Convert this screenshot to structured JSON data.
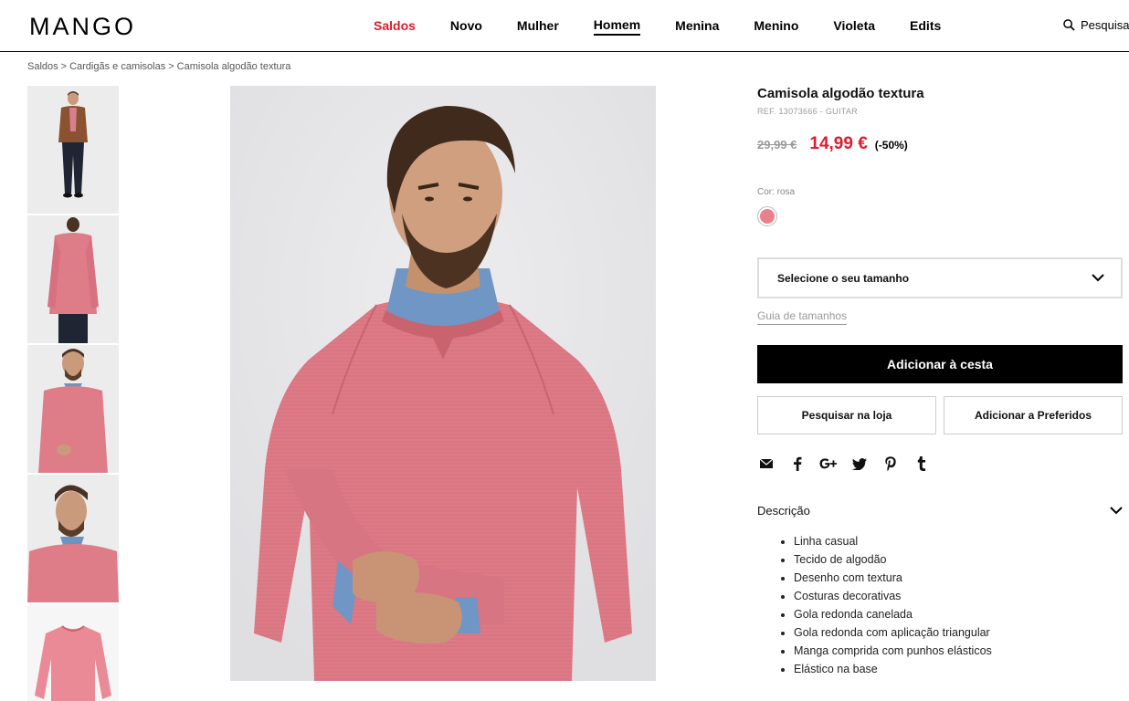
{
  "header": {
    "logo": "MANGO",
    "nav": [
      {
        "label": "Saldos"
      },
      {
        "label": "Novo"
      },
      {
        "label": "Mulher"
      },
      {
        "label": "Homem"
      },
      {
        "label": "Menina"
      },
      {
        "label": "Menino"
      },
      {
        "label": "Violeta"
      },
      {
        "label": "Edits"
      }
    ],
    "search_label": "Pesquisar",
    "active_nav": "Homem",
    "sale_color": "#e21a2c"
  },
  "breadcrumb": {
    "items": [
      "Saldos",
      "Cardigãs e camisolas",
      "Camisola algodão textura"
    ],
    "separator": ">"
  },
  "product": {
    "title": "Camisola algodão textura",
    "ref": "REF. 13073666 - GUITAR",
    "old_price": "29,99 €",
    "new_price": "14,99 €",
    "discount": "(-50%)",
    "color_label": "Cor: rosa",
    "swatch_color": "#e8818c",
    "size_placeholder": "Selecione o seu tamanho",
    "size_guide": "Guia de tamanhos",
    "add_to_cart": "Adicionar à cesta",
    "find_in_store": "Pesquisar na loja",
    "add_to_favorites": "Adicionar a Preferidos",
    "share_icons": [
      "mail-icon",
      "facebook-icon",
      "google-plus-icon",
      "twitter-icon",
      "pinterest-icon",
      "tumblr-icon"
    ],
    "description_title": "Descrição",
    "description_items": [
      "Linha casual",
      "Tecido de algodão",
      "Desenho com textura",
      "Costuras decorativas",
      "Gola redonda canelada",
      "Gola redonda com aplicação triangular",
      "Manga comprida com punhos elásticos",
      "Elástico na base"
    ]
  }
}
